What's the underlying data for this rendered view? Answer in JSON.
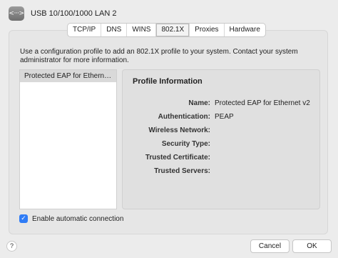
{
  "header": {
    "icon": "ethernet-dots-icon",
    "icon_glyph": "<···>",
    "title": "USB 10/100/1000 LAN 2"
  },
  "tabs": [
    {
      "label": "TCP/IP",
      "active": false
    },
    {
      "label": "DNS",
      "active": false
    },
    {
      "label": "WINS",
      "active": false
    },
    {
      "label": "802.1X",
      "active": true
    },
    {
      "label": "Proxies",
      "active": false
    },
    {
      "label": "Hardware",
      "active": false
    }
  ],
  "description": {
    "line1": "Use a configuration profile to add an 802.1X profile to your system. Contact your system",
    "line2": "administrator for more information."
  },
  "profiles": [
    {
      "label": "Protected EAP for Ethern…",
      "selected": true
    }
  ],
  "profile_info": {
    "title": "Profile Information",
    "fields": [
      {
        "label": "Name:",
        "value": "Protected EAP for Ethernet v2"
      },
      {
        "label": "Authentication:",
        "value": "PEAP"
      },
      {
        "label": "Wireless Network:",
        "value": ""
      },
      {
        "label": "Security Type:",
        "value": ""
      },
      {
        "label": "Trusted Certificate:",
        "value": ""
      },
      {
        "label": "Trusted Servers:",
        "value": ""
      }
    ]
  },
  "auto_connect": {
    "label": "Enable automatic connection",
    "checked": true,
    "check_glyph": "✓"
  },
  "help_button": {
    "label": "?"
  },
  "buttons": {
    "cancel_label": "Cancel",
    "ok_label": "OK"
  },
  "colors": {
    "accent": "#2f7cf6",
    "window_bg": "#ececec",
    "list_selection": "#d9d9d9"
  }
}
